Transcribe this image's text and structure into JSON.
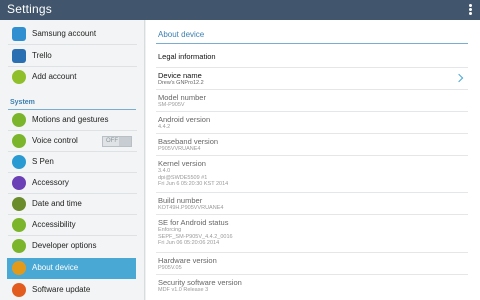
{
  "app": {
    "title": "Settings"
  },
  "left": {
    "items_top": [
      {
        "label": "Samsung account",
        "icon": "samsung-account-icon",
        "color": "#2f8fd0"
      },
      {
        "label": "Trello",
        "icon": "trello-icon",
        "color": "#2b6fb3"
      },
      {
        "label": "Add account",
        "icon": "add-account-icon",
        "color": "#8fbf2a"
      }
    ],
    "section": "System",
    "items": [
      {
        "label": "Motions and gestures",
        "icon": "motions-gestures-icon",
        "color": "#7bb52b"
      },
      {
        "label": "Voice control",
        "icon": "voice-control-icon",
        "color": "#7bb52b",
        "toggle": "OFF"
      },
      {
        "label": "S Pen",
        "icon": "s-pen-icon",
        "color": "#2a9ad3"
      },
      {
        "label": "Accessory",
        "icon": "accessory-icon",
        "color": "#6b3fb5"
      },
      {
        "label": "Date and time",
        "icon": "date-time-icon",
        "color": "#6b8c2a"
      },
      {
        "label": "Accessibility",
        "icon": "accessibility-icon",
        "color": "#7bb52b"
      },
      {
        "label": "Developer options",
        "icon": "developer-options-icon",
        "color": "#7bb52b"
      },
      {
        "label": "About device",
        "icon": "about-device-icon",
        "color": "#e39a1a",
        "selected": true
      },
      {
        "label": "Software update",
        "icon": "software-update-icon",
        "color": "#e25c1f"
      }
    ]
  },
  "right": {
    "title": "About device",
    "legal": "Legal information",
    "device_name": {
      "label": "Device name",
      "value": "Drew's GNPro12.2"
    },
    "info": [
      {
        "label": "Model number",
        "lines": [
          "SM-P905V"
        ]
      },
      {
        "label": "Android version",
        "lines": [
          "4.4.2"
        ]
      },
      {
        "label": "Baseband version",
        "lines": [
          "P905VVRUANE4"
        ]
      },
      {
        "label": "Kernel version",
        "lines": [
          "3.4.0",
          "dpi@SWDE5509 #1",
          "Fri Jun 6 05:20:30 KST 2014"
        ]
      },
      {
        "label": "Build number",
        "lines": [
          "KOT49H.P905VVRUANE4"
        ]
      },
      {
        "label": "SE for Android status",
        "lines": [
          "Enforcing",
          "SEPF_SM-P905V_4.4.2_0016",
          "Fri Jun 06 05:20:06 2014"
        ]
      },
      {
        "label": "Hardware version",
        "lines": [
          "P905V.05"
        ]
      },
      {
        "label": "Security software version",
        "lines": [
          "MDF v1.0 Release 3"
        ]
      }
    ]
  }
}
